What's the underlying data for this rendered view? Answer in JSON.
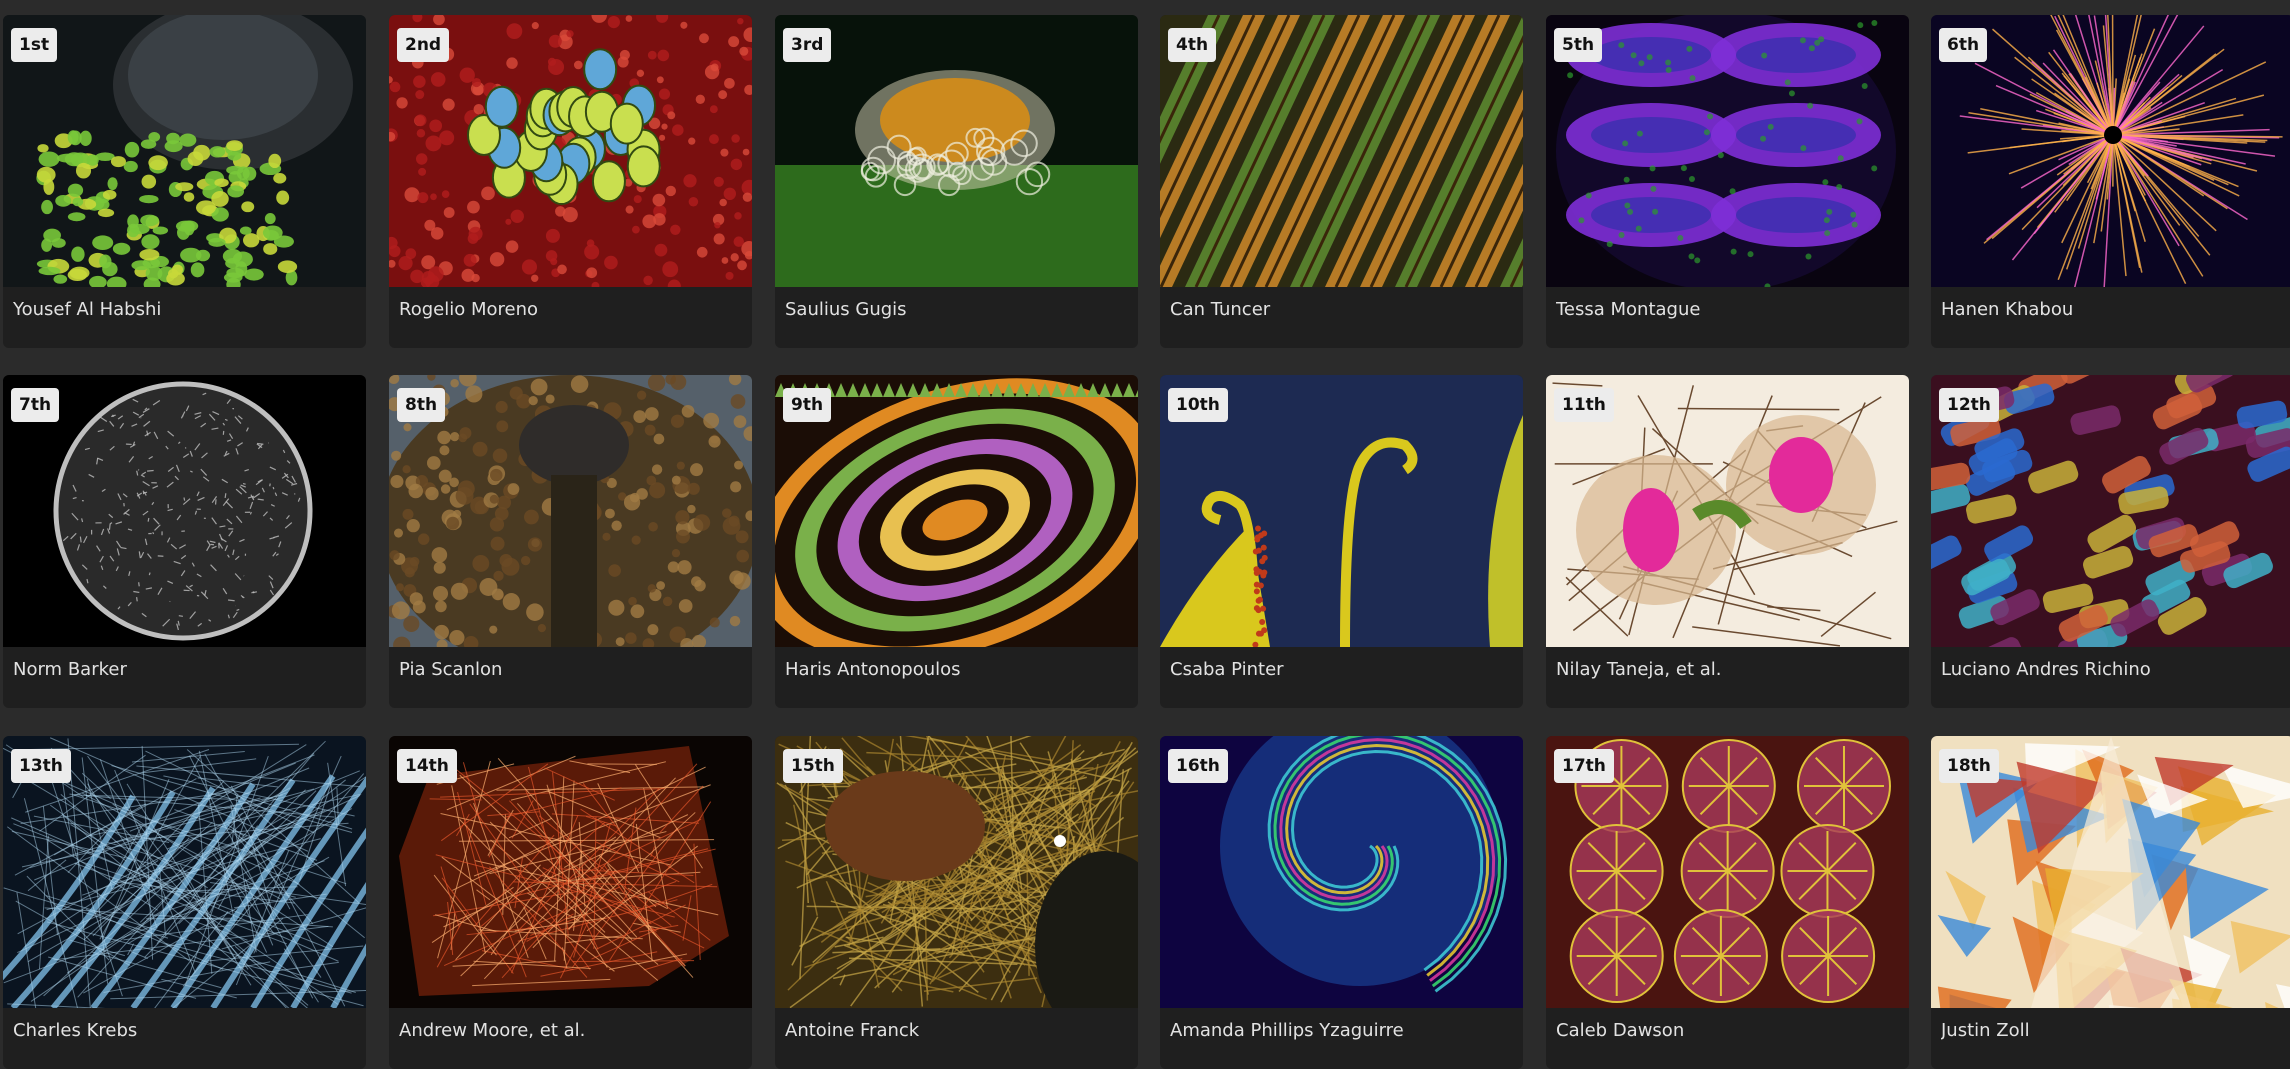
{
  "gallery": {
    "entries": [
      {
        "rank": "1st",
        "photographer": "Yousef Al Habshi",
        "art": "eye",
        "colors": [
          "#111618",
          "#79c83a",
          "#2a2e31"
        ]
      },
      {
        "rank": "2nd",
        "photographer": "Rogelio Moreno",
        "art": "cluster",
        "colors": [
          "#7a0f0f",
          "#c9df4f",
          "#5fa7d8"
        ]
      },
      {
        "rank": "3rd",
        "photographer": "Saulius Gugis",
        "art": "egg",
        "colors": [
          "#07120a",
          "#cc8a1e",
          "#2d6b1c"
        ]
      },
      {
        "rank": "4th",
        "photographer": "Can Tuncer",
        "art": "feathers",
        "colors": [
          "#2b2a12",
          "#d08a2a",
          "#5e8d31"
        ]
      },
      {
        "rank": "5th",
        "photographer": "Tessa Montague",
        "art": "lobes",
        "colors": [
          "#090410",
          "#7e2fd6",
          "#2c9a2c"
        ]
      },
      {
        "rank": "6th",
        "photographer": "Hanen Khabou",
        "art": "starburst",
        "colors": [
          "#0a0522",
          "#ffb24a",
          "#7b3ff1"
        ]
      },
      {
        "rank": "7th",
        "photographer": "Norm Barker",
        "art": "disc",
        "colors": [
          "#000000",
          "#bfbfbf",
          "#555555"
        ]
      },
      {
        "rank": "8th",
        "photographer": "Pia Scanlon",
        "art": "weevil",
        "colors": [
          "#4a3a22",
          "#a07a44",
          "#2a2418"
        ]
      },
      {
        "rank": "9th",
        "photographer": "Haris Antonopoulos",
        "art": "ellipses",
        "colors": [
          "#1b0d06",
          "#e08a22",
          "#7ab04a"
        ]
      },
      {
        "rank": "10th",
        "photographer": "Csaba Pinter",
        "art": "fern",
        "colors": [
          "#1d2a52",
          "#d9c81d",
          "#c03a1a"
        ]
      },
      {
        "rank": "11th",
        "photographer": "Nilay Taneja, et al.",
        "art": "cells",
        "colors": [
          "#f4ecdf",
          "#e32a9a",
          "#5a8a2a"
        ]
      },
      {
        "rank": "12th",
        "photographer": "Luciano Andres Richino",
        "art": "scales",
        "colors": [
          "#3a0f1f",
          "#3fb0c8",
          "#d0603a"
        ]
      },
      {
        "rank": "13th",
        "photographer": "Charles Krebs",
        "art": "fronds",
        "colors": [
          "#0a1420",
          "#7ab8e0",
          "#2a4a6a"
        ]
      },
      {
        "rank": "14th",
        "photographer": "Andrew Moore, et al.",
        "art": "web",
        "colors": [
          "#0a0503",
          "#e2552a",
          "#ffb070"
        ]
      },
      {
        "rank": "15th",
        "photographer": "Antoine Franck",
        "art": "mite",
        "colors": [
          "#3c2e10",
          "#a8842e",
          "#6a3a1a"
        ]
      },
      {
        "rank": "16th",
        "photographer": "Amanda Phillips Yzaguirre",
        "art": "spiral",
        "colors": [
          "#0e0440",
          "#3fd0d8",
          "#f0d030"
        ]
      },
      {
        "rank": "17th",
        "photographer": "Caleb Dawson",
        "art": "lobules",
        "colors": [
          "#4a1410",
          "#e0c23a",
          "#a83a5a"
        ]
      },
      {
        "rank": "18th",
        "photographer": "Justin Zoll",
        "art": "crystal",
        "colors": [
          "#f0e0c0",
          "#e06a1a",
          "#3a8ad8"
        ]
      }
    ]
  }
}
